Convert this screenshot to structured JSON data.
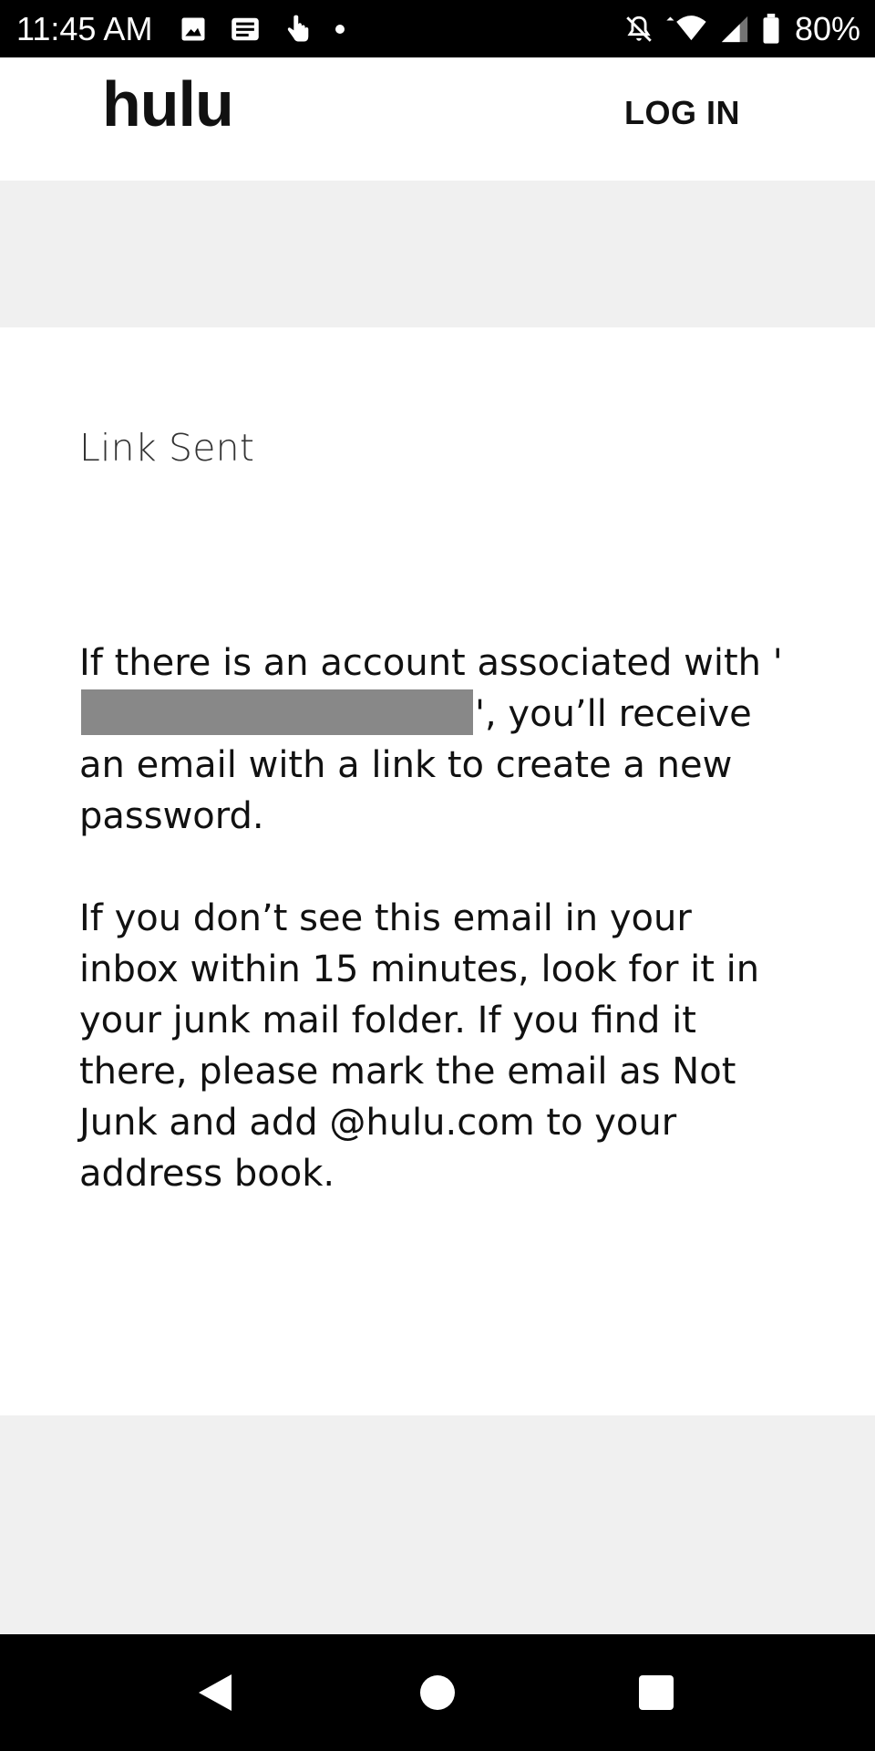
{
  "status_bar": {
    "time": "11:45 AM",
    "battery_percent": "80%",
    "icons_left": [
      "image-icon",
      "news-icon",
      "touch-icon",
      "dot-icon"
    ],
    "icons_right": [
      "notifications-off-icon",
      "wifi-icon",
      "signal-icon",
      "battery-icon"
    ]
  },
  "header": {
    "logo_text": "hulu",
    "login_label": "LOG IN"
  },
  "card": {
    "title": "Link Sent",
    "para1_before": "If there is an account associated with '",
    "para1_after": "', you’ll receive an email with a link to create a new password.",
    "para2": "If you don’t see this email in your inbox within 15 minutes, look for it in your junk mail folder. If you find it there, please mark the email as Not Junk and add @hulu.com to your address book."
  },
  "nav": {
    "buttons": [
      "back-icon",
      "home-icon",
      "recents-icon"
    ]
  },
  "colors": {
    "background": "#ffffff",
    "band": "#f0f0f0",
    "status_bar": "#000000",
    "redaction": "#888888",
    "text": "#111111"
  }
}
